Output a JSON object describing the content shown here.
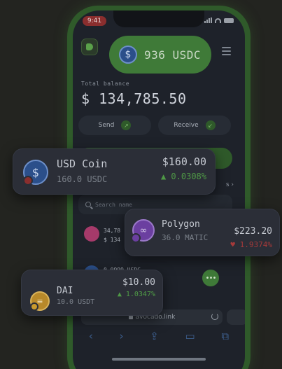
{
  "status_bar": {
    "time": "9:41"
  },
  "header": {
    "balance_chip": "936 USDC"
  },
  "wallet": {
    "total_balance_label": "Total balance",
    "total_balance_value": "$ 134,785.50",
    "send_label": "Send",
    "receive_label": "Receive",
    "tokens_link": "s ›",
    "search_placeholder": "Search name"
  },
  "rows": [
    {
      "line1": "34,78",
      "line2": "$ 134"
    },
    {
      "line1": "0.0999 USDC",
      "line2": ""
    }
  ],
  "browser": {
    "url": "avocado.link"
  },
  "cards": {
    "usd_coin": {
      "name": "USD Coin",
      "amount": "160.0 USDC",
      "price": "$160.00",
      "change": "▲ 0.0308%"
    },
    "polygon": {
      "name": "Polygon",
      "amount": "36.0 MATIC",
      "price": "$223.20",
      "change": "♥ 1.9374%"
    },
    "dai": {
      "name": "DAI",
      "amount": "10.0 USDT",
      "price": "$10.00",
      "change": "▲ 1.0347%"
    }
  },
  "colors": {
    "brand_green": "#3f7a38",
    "positive": "#4f9a46",
    "negative": "#a63a3a",
    "usdc_blue": "#2b4f8a"
  }
}
